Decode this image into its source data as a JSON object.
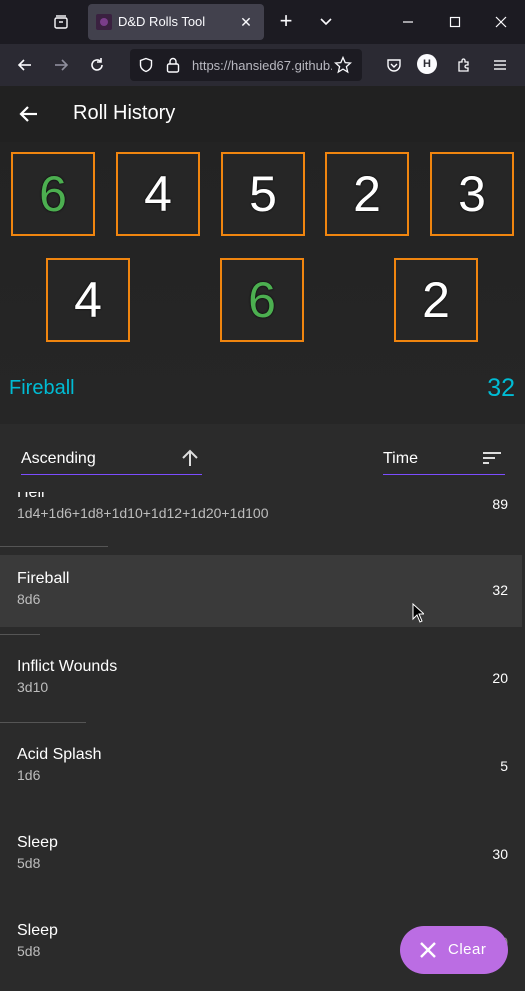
{
  "browser": {
    "tab_title": "D&D Rolls Tool",
    "url": "https://hansied67.github.io",
    "profile_initial": "H"
  },
  "app": {
    "title": "Roll History"
  },
  "current_roll": {
    "dice": [
      6,
      4,
      5,
      2,
      3,
      4,
      6,
      2
    ],
    "max_flags": [
      true,
      false,
      false,
      false,
      false,
      false,
      true,
      false
    ],
    "name": "Fireball",
    "total": "32"
  },
  "sort": {
    "order_label": "Ascending",
    "field_label": "Time"
  },
  "history": [
    {
      "name": "Hell",
      "dice": "1d4+1d6+1d8+1d10+1d12+1d20+1d100",
      "value": "89"
    },
    {
      "name": "Fireball",
      "dice": "8d6",
      "value": "32"
    },
    {
      "name": "Inflict Wounds",
      "dice": "3d10",
      "value": "20"
    },
    {
      "name": "Acid Splash",
      "dice": "1d6",
      "value": "5"
    },
    {
      "name": "Sleep",
      "dice": "5d8",
      "value": "30"
    },
    {
      "name": "Sleep",
      "dice": "5d8",
      "value": "20"
    }
  ],
  "fab": {
    "label": "Clear"
  },
  "colors": {
    "accent": "#00bcd4",
    "die_border": "#f0850f",
    "max_roll": "#4caf50",
    "fab": "#bb6de3",
    "underline": "#7c4dff"
  }
}
